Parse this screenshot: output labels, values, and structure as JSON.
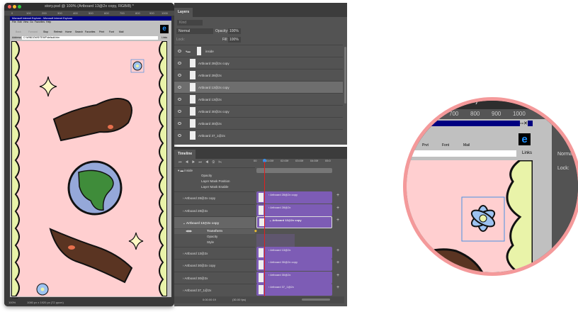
{
  "document": {
    "title": "story.psd @ 100% (Artboard 13@2x copy, RGB/8) *",
    "ruler_ticks": [
      "0",
      "100",
      "200",
      "300",
      "400",
      "500",
      "600",
      "700",
      "800",
      "900",
      "1000"
    ],
    "zoom": "100%",
    "dimensions": "1080 px x 1920 px (72 ppcm)"
  },
  "ie": {
    "title": "Microsoft Internet Explorer - Microsoft Internet Explorer",
    "menu": [
      "File",
      "Edit",
      "View",
      "Go",
      "Favorites",
      "Help"
    ],
    "toolbar": [
      "Back",
      "Forward",
      "Stop",
      "Refresh",
      "Home",
      "Search",
      "Favorites",
      "Print",
      "Font",
      "Mail"
    ],
    "address_label": "Address",
    "address": "C:\\WINDOWS\\TEMP\\default.htm",
    "links": "Links",
    "status": "Done"
  },
  "layers": {
    "tab": "Layers",
    "kind": "Kind",
    "blend": "Normal",
    "opacity_label": "Opacity:",
    "opacity": "100%",
    "lock_label": "Lock:",
    "fill_label": "Fill:",
    "fill": "100%",
    "items": [
      {
        "name": "inside",
        "group": true
      },
      {
        "name": "Artboard 28@2x copy"
      },
      {
        "name": "Artboard 28@2x"
      },
      {
        "name": "Artboard 13@2x copy",
        "selected": true
      },
      {
        "name": "Artboard 13@2x"
      },
      {
        "name": "Artboard 30@2x copy"
      },
      {
        "name": "Artboard 30@2x"
      },
      {
        "name": "Artboard 37_1@2x"
      }
    ]
  },
  "timeline": {
    "tab": "Timeline",
    "ticks": [
      "00",
      "01:00f",
      "02:00f",
      "03:00f",
      "04:00f",
      "05:0"
    ],
    "group": "inside",
    "group_props": [
      "Opacity",
      "Layer Mask Position",
      "Layer Mask Enable"
    ],
    "tracks": [
      {
        "name": "Artboard 28@2x copy"
      },
      {
        "name": "Artboard 28@2x"
      },
      {
        "name": "Artboard 13@2x copy",
        "expanded": true,
        "props": [
          "Transform",
          "Opacity",
          "Style"
        ]
      },
      {
        "name": "Artboard 13@2x"
      },
      {
        "name": "Artboard 30@2x copy"
      },
      {
        "name": "Artboard 30@2x"
      },
      {
        "name": "Artboard 37_1@2x"
      }
    ],
    "timecode": "0:00:00:19",
    "fps": "(30.00 fps)"
  },
  "magnifier": {
    "title_fragment": "py, RGB/8) *",
    "ruler": [
      "700",
      "800",
      "900",
      "1000"
    ],
    "toolbar": [
      "Prvt",
      "Font",
      "Mail"
    ],
    "links": "Links",
    "blend": "Norma",
    "lock": "Lock:"
  },
  "colors": {
    "canvas": "#ffcfd0",
    "scallop": "#e9f3a9",
    "clip": "#7d5cb5",
    "playhead": "#e02020",
    "magnifier_ring": "#f4999a",
    "ie_title": "#000080"
  }
}
